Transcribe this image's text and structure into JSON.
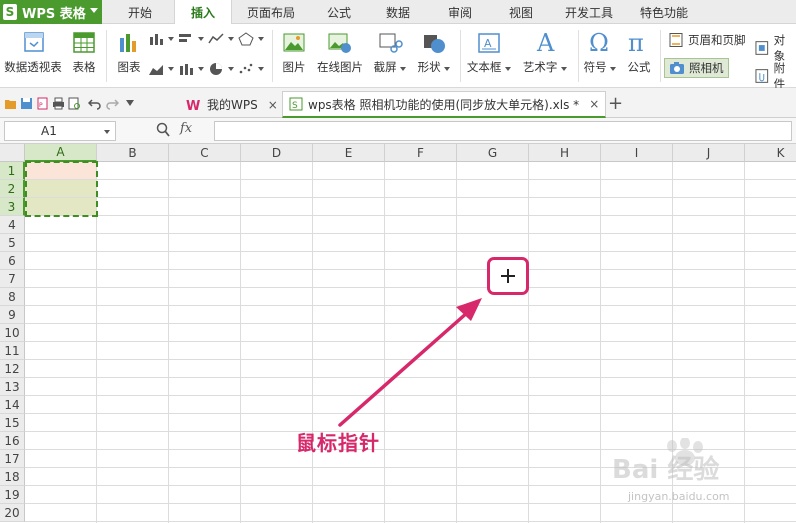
{
  "app": {
    "name": "WPS 表格",
    "logo": "S"
  },
  "menu": {
    "tabs": [
      {
        "label": "开始",
        "active": false
      },
      {
        "label": "插入",
        "active": true
      },
      {
        "label": "页面布局",
        "active": false
      },
      {
        "label": "公式",
        "active": false
      },
      {
        "label": "数据",
        "active": false
      },
      {
        "label": "审阅",
        "active": false
      },
      {
        "label": "视图",
        "active": false
      },
      {
        "label": "开发工具",
        "active": false
      },
      {
        "label": "特色功能",
        "active": false
      }
    ]
  },
  "ribbon": {
    "pivot_table": "数据透视表",
    "table": "表格",
    "chart": "图表",
    "picture": "图片",
    "online_picture": "在线图片",
    "screenshot": "截屏",
    "shapes": "形状",
    "textbox": "文本框",
    "wordart": "艺术字",
    "symbol": "符号",
    "formula": "公式",
    "header_footer": "页眉和页脚",
    "camera": "照相机",
    "object": "对象",
    "attachment": "附件"
  },
  "doc_tabs": [
    {
      "label": "我的WPS",
      "active": false,
      "close": "×"
    },
    {
      "label": "wps表格 照相机功能的使用(同步放大单元格).xls *",
      "active": true,
      "close": "×"
    }
  ],
  "new_tab": "+",
  "formula_bar": {
    "cell_ref": "A1",
    "fx": "fx",
    "value": ""
  },
  "grid": {
    "columns": [
      "A",
      "B",
      "C",
      "D",
      "E",
      "F",
      "G",
      "H",
      "I",
      "J",
      "K"
    ],
    "rows": [
      "1",
      "2",
      "3",
      "4",
      "5",
      "6",
      "7",
      "8",
      "9",
      "10",
      "11",
      "12",
      "13",
      "14",
      "15",
      "16",
      "17",
      "18",
      "19",
      "20"
    ],
    "selected_column": "A",
    "selected_rows": [
      "1",
      "2",
      "3"
    ],
    "cell_fills": {
      "A1": "#fbe4d8",
      "A2": "#e3e7c4",
      "A3": "#e3e7c4"
    }
  },
  "annotation": {
    "label": "鼠标指针",
    "color": "#d6286a"
  },
  "watermark": {
    "brand": "Bai 经验",
    "url": "jingyan.baidu.com"
  },
  "colors": {
    "accent": "#4a9a2e",
    "annotation": "#d6286a"
  }
}
